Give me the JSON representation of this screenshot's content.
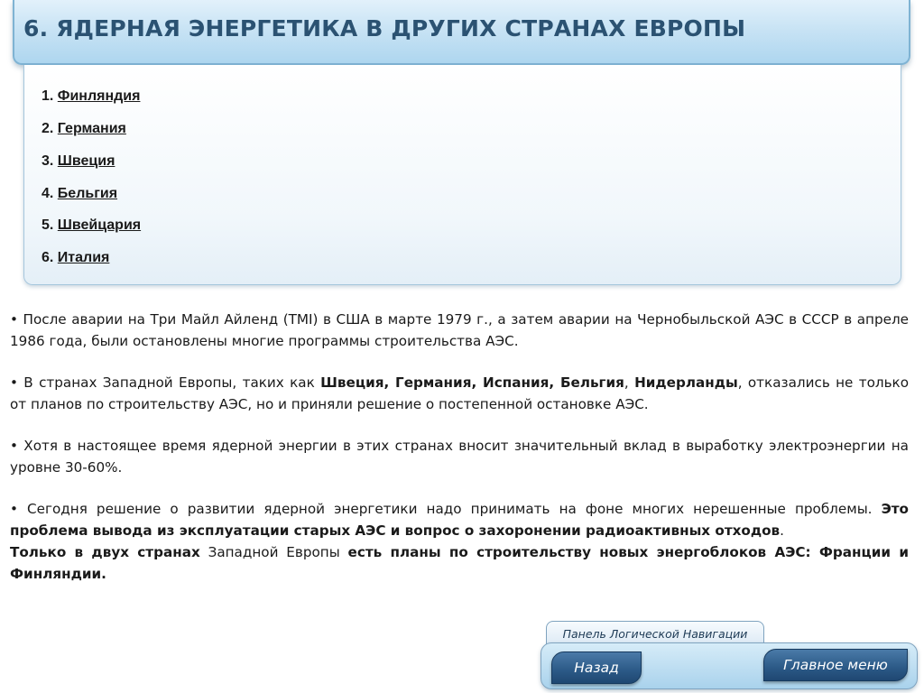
{
  "header": {
    "title": "6. ЯДЕРНАЯ ЭНЕРГЕТИКА В ДРУГИХ СТРАНАХ ЕВРОПЫ"
  },
  "country_list": [
    {
      "number": "1. ",
      "label": "Финляндия"
    },
    {
      "number": "2. ",
      "label": "Германия"
    },
    {
      "number": "3. ",
      "label": "Швеция"
    },
    {
      "number": "4. ",
      "label": "Бельгия"
    },
    {
      "number": "5. ",
      "label": "Швейцария"
    },
    {
      "number": "6. ",
      "label": "Италия"
    }
  ],
  "paragraphs": {
    "p1": "• После аварии на Три Майл Айленд (TMI) в США в марте 1979 г., а затем  аварии на Чернобыльской АЭС в СССР в апреле 1986 года, были  остановлены многие программы строительства АЭС.",
    "p2_a": "• В странах  Западной Европы, таких как ",
    "p2_b": "Швеция, Германия, Испания, Бельгия",
    "p2_c": ", ",
    "p2_d": "Нидерланды",
    "p2_e": ", отказались не только от планов по строительству  АЭС, но и приняли решение  о постепенной остановке АЭС.",
    "p3": "• Хотя в настоящее время ядерной энергии в этих странах вносит значительный вклад в выработку электроэнергии на уровне 30-60%.",
    "p4_a": "• Сегодня  решение о развитии ядерной энергетики надо принимать на фоне многих  нерешенные проблемы. ",
    "p4_b": "Это проблема  вывода из эксплуатации старых АЭС и вопрос о захоронении радиоактивных отходов",
    "p4_c": ".",
    "p5_a": "Только в двух странах",
    "p5_b": " Западной Европы ",
    "p5_c": "есть планы по строительству новых энергоблоков АЭС: Франции и Финляндии."
  },
  "navigation": {
    "panel_label": "Панель Логической Навигации",
    "back_label": "Назад",
    "main_menu_label": "Главное меню"
  }
}
